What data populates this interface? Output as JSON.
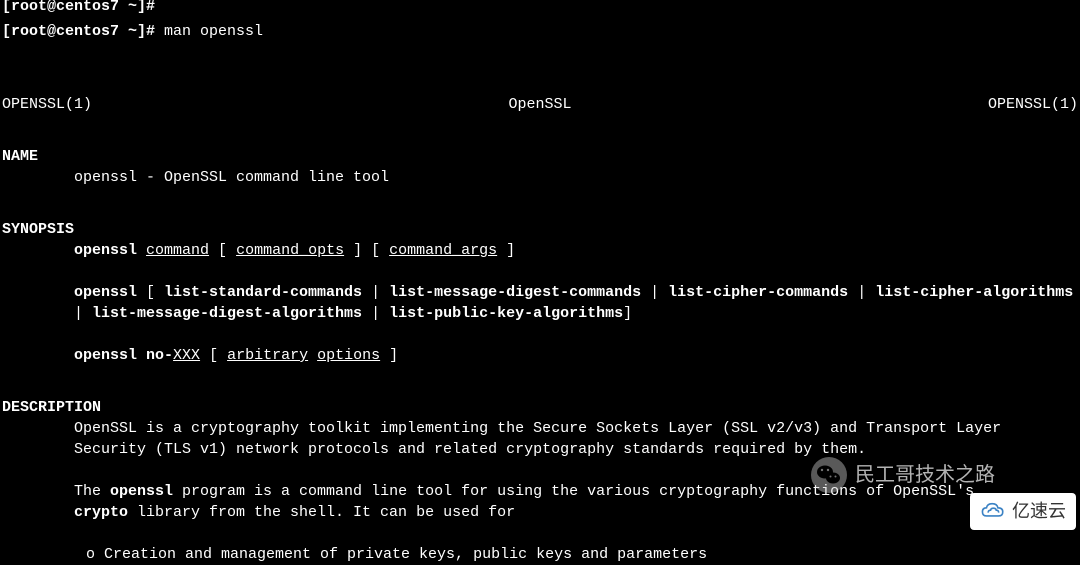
{
  "prompt": {
    "prefix_cut": "[root@centos7 ~]#",
    "prompt": "[root@centos7 ~]#",
    "command": " man openssl"
  },
  "man": {
    "header_left": "OPENSSL(1)",
    "header_center": "OpenSSL",
    "header_right": "OPENSSL(1)",
    "sec_name": "NAME",
    "name_line": "openssl - OpenSSL command line tool",
    "sec_synopsis": "SYNOPSIS",
    "syn1": {
      "openssl": "openssl",
      "command": "command",
      "command_opts": "command_opts",
      "command_args": "command_args"
    },
    "syn2": {
      "openssl": "openssl",
      "l1": "list-standard-commands",
      "l2": "list-message-digest-commands",
      "l3": "list-cipher-commands",
      "l4": "list-cipher-algorithms",
      "l5": "list-message-digest-algorithms",
      "l6": "list-public-key-algorithms"
    },
    "syn3": {
      "openssl": "openssl",
      "no": "no-",
      "xxx": "XXX",
      "arbitrary": "arbitrary",
      "options": "options"
    },
    "sec_description": "DESCRIPTION",
    "desc_p1": "OpenSSL is a cryptography toolkit implementing the Secure Sockets Layer (SSL v2/v3) and Transport Layer Security (TLS v1) network protocols and related cryptography standards required by them.",
    "desc_p2_a": "The ",
    "desc_p2_openssl": "openssl",
    "desc_p2_b": " program is a command line tool for using the various cryptography functions of OpenSSL's ",
    "desc_p2_crypto": "crypto",
    "desc_p2_c": " library from the shell.  It can be used for",
    "bullet1": " o  Creation and management of private keys, public keys and parameters"
  },
  "watermark": {
    "wechat_text": "民工哥技术之路",
    "yisu_text": "亿速云"
  }
}
